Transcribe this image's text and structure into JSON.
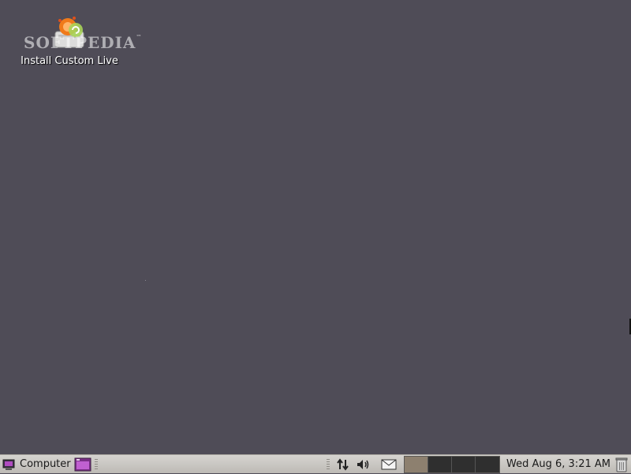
{
  "desktop": {
    "background": "#4f4c57",
    "icons": [
      {
        "label": "Install Custom Live",
        "icon": "installer-icon"
      }
    ],
    "watermark": "SOFTPEDIA",
    "watermark_tm": "™"
  },
  "panel": {
    "menu_label": "Computer",
    "clock": "Wed Aug  6,  3:21 AM",
    "workspaces": [
      {
        "active": true
      },
      {
        "active": false
      },
      {
        "active": false
      },
      {
        "active": false
      }
    ],
    "tray_icons": [
      "network-icon",
      "volume-icon",
      "mail-icon"
    ],
    "accent": "#9b3fa5"
  }
}
